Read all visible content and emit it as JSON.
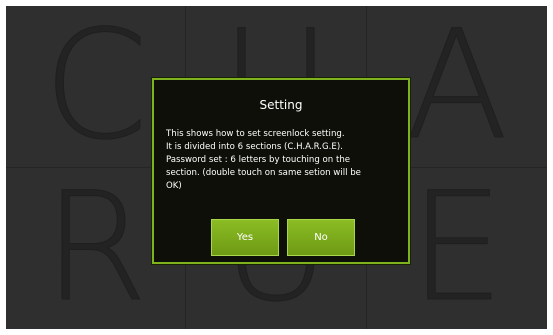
{
  "background": {
    "letters": [
      "C",
      "U",
      "A",
      "R",
      "U",
      "E"
    ]
  },
  "dialog": {
    "title": "Setting",
    "message": "This shows how to set screenlock setting.\nIt is divided into 6 sections (C.H.A.R.G.E).\nPassword set : 6 letters by touching on the\nsection. (double touch on same setion will be\nOK)",
    "yes_label": "Yes",
    "no_label": "No"
  },
  "colors": {
    "accent": "#7fb21f",
    "button": "#7aa81a",
    "dialog_bg": "#0d0f08",
    "screen_bg": "#3a3a3a"
  }
}
